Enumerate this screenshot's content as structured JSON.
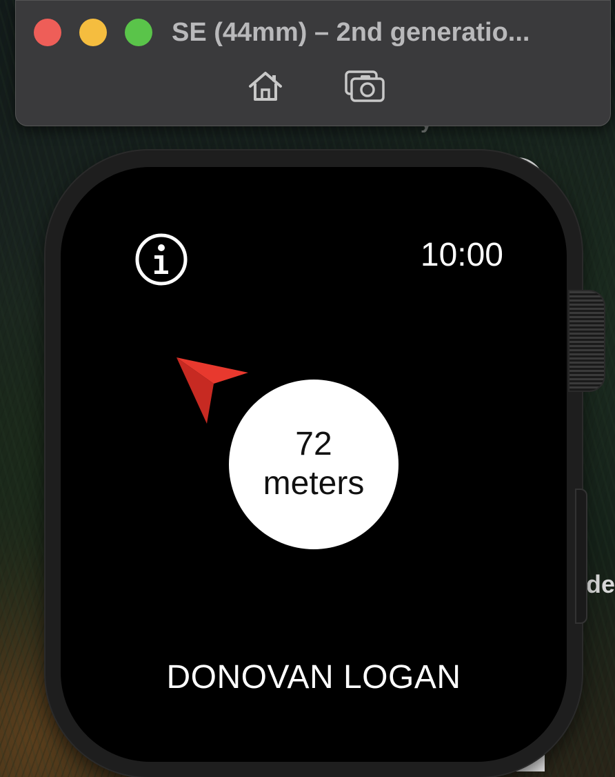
{
  "window": {
    "title": "SE (44mm) – 2nd generatio...",
    "home_icon": "home-icon",
    "screenshot_icon": "camera-icon"
  },
  "background": {
    "partial_text_top": "y",
    "partial_text_right": "de"
  },
  "watch": {
    "time": "10:00",
    "info_icon": "info-icon",
    "pointer_icon": "location-arrow-icon",
    "distance": {
      "value": "72",
      "unit": "meters"
    },
    "target_name": "DONOVAN LOGAN"
  },
  "colors": {
    "close": "#ee5e58",
    "minimize": "#f5bd3f",
    "zoom": "#5ac44a",
    "pointer": "#e0352b",
    "screen": "#000000",
    "circle": "#ffffff"
  }
}
